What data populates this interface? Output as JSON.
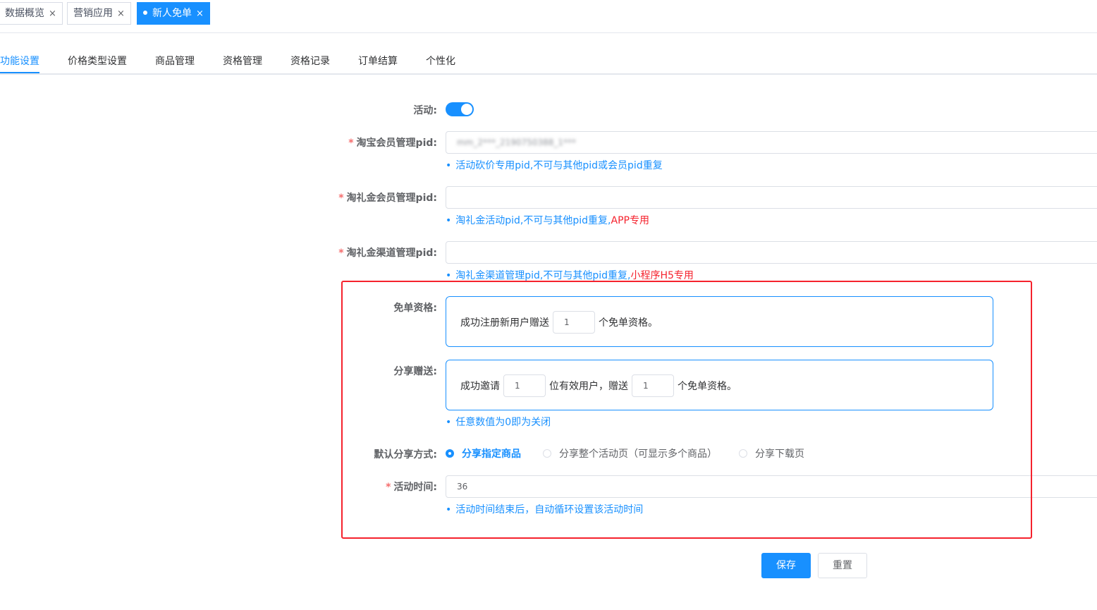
{
  "page_tabs": [
    {
      "label": "数据概览",
      "close": "×"
    },
    {
      "label": "营销应用",
      "close": "×"
    },
    {
      "label": "新人免单",
      "close": "×",
      "active": true
    }
  ],
  "sub_tabs": [
    "功能设置",
    "价格类型设置",
    "商品管理",
    "资格管理",
    "资格记录",
    "订单结算",
    "个性化"
  ],
  "colors": {
    "accent": "#1890ff",
    "required": "#f56c6c",
    "highlight": "#f5222d"
  },
  "form": {
    "activity": {
      "label": "活动:",
      "enabled": true
    },
    "tb_member_pid": {
      "label": "淘宝会员管理pid:",
      "value": "mm_2***_2190750388_1***",
      "hint": "活动砍价专用pid,不可与其他pid或会员pid重复"
    },
    "tlj_member_pid": {
      "label": "淘礼金会员管理pid:",
      "value": "",
      "hint": "淘礼金活动pid,不可与其他pid重复,",
      "hint_red": "APP专用"
    },
    "tlj_channel_pid": {
      "label": "淘礼金渠道管理pid:",
      "value": "",
      "hint": "淘礼金渠道管理pid,不可与其他pid重复,",
      "hint_red": "小程序H5专用"
    },
    "free_quota": {
      "label": "免单资格:",
      "text_before": "成功注册新用户赠送",
      "value": "1",
      "text_after": "个免单资格。"
    },
    "share_gift": {
      "label": "分享赠送:",
      "text_1": "成功邀请",
      "value_1": "1",
      "text_2": "位有效用户，赠送",
      "value_2": "1",
      "text_3": "个免单资格。",
      "hint": "任意数值为0即为关闭"
    },
    "share_mode": {
      "label": "默认分享方式:",
      "options": [
        "分享指定商品",
        "分享整个活动页（可显示多个商品）",
        "分享下载页"
      ],
      "selected": "分享指定商品"
    },
    "activity_time": {
      "label": "活动时间:",
      "value": "36",
      "hint": "活动时间结束后，自动循环设置该活动时间"
    }
  },
  "bullet": "•",
  "required_mark": "*",
  "buttons": {
    "save": "保存",
    "reset": "重置"
  }
}
